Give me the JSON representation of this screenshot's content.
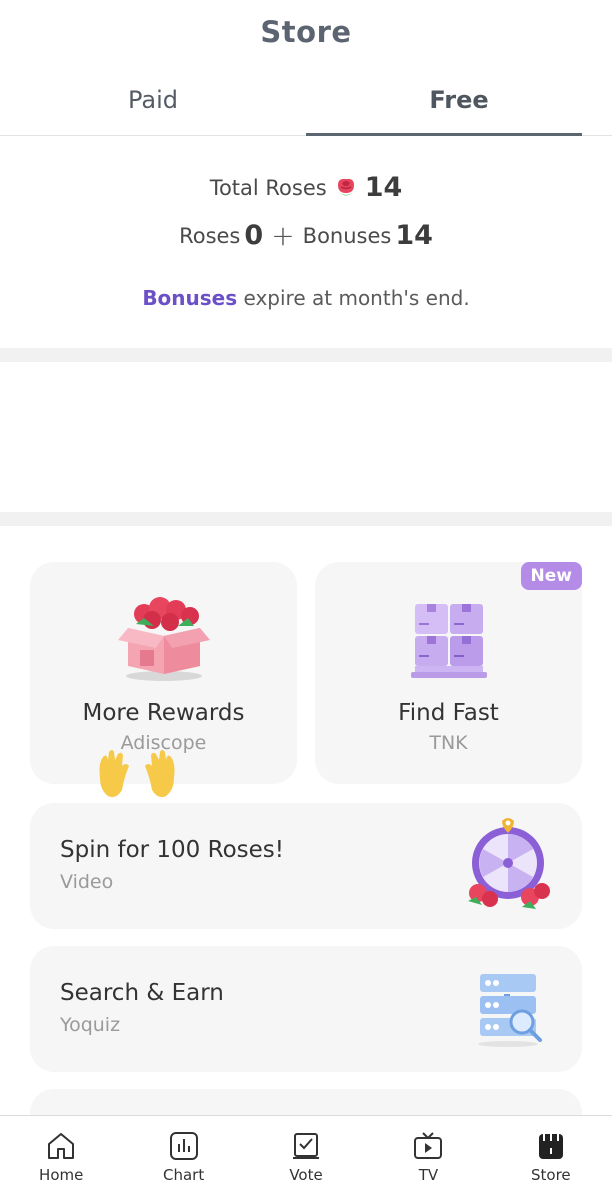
{
  "header": {
    "title": "Store"
  },
  "tabs": [
    {
      "label": "Paid",
      "active": false
    },
    {
      "label": "Free",
      "active": true
    }
  ],
  "summary": {
    "total_label": "Total Roses",
    "total_value": "14",
    "roses_label": "Roses",
    "roses_value": "0",
    "plus_sign": "+",
    "bonuses_label": "Bonuses",
    "bonuses_value": "14",
    "expire_highlight": "Bonuses",
    "expire_rest": " expire at month's end."
  },
  "tiles": [
    {
      "title": "More Rewards",
      "subtitle": "Adiscope",
      "icon": "rose-box-icon"
    },
    {
      "title": "Find Fast",
      "subtitle": "TNK",
      "badge": "New",
      "icon": "boxes-pallet-icon"
    }
  ],
  "rows": [
    {
      "title": "Spin for 100 Roses!",
      "subtitle": "Video",
      "icon": "prize-wheel-icon"
    },
    {
      "title": "Search & Earn",
      "subtitle": "Yoquiz",
      "icon": "server-search-icon"
    }
  ],
  "bottom_nav": [
    {
      "label": "Home",
      "icon": "home-icon"
    },
    {
      "label": "Chart",
      "icon": "chart-icon"
    },
    {
      "label": "Vote",
      "icon": "vote-icon"
    },
    {
      "label": "TV",
      "icon": "tv-icon"
    },
    {
      "label": "Store",
      "icon": "store-icon",
      "active": true
    }
  ],
  "colors": {
    "accent": "#6b50c8",
    "badge": "#b48be6",
    "card_bg": "#f6f6f6",
    "divider": "#f1f1f1"
  }
}
